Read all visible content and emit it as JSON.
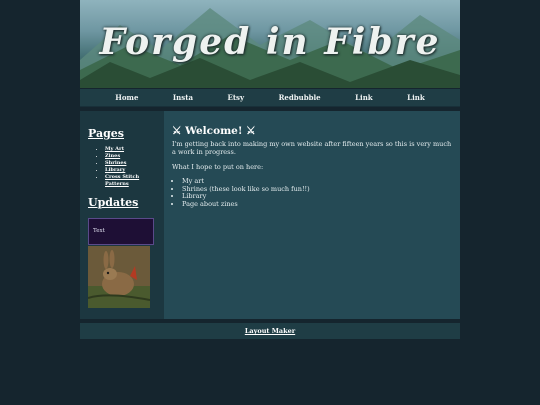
{
  "header": {
    "title": "Forged in Fibre"
  },
  "nav": [
    "Home",
    "Insta",
    "Etsy",
    "Redbubble",
    "Link",
    "Link"
  ],
  "sidebar": {
    "pages_heading": "Pages",
    "pages": [
      "My Art",
      "Zines",
      "Shrines",
      "Library",
      "Cross Stitch Patterns"
    ],
    "updates_heading": "Updates",
    "update_text": "Text"
  },
  "main": {
    "heading": "⚔ Welcome! ⚔",
    "intro": "I'm getting back into making my own website after fifteen years so this is very much a work in progress.",
    "hope": "What I hope to put on here:",
    "items": [
      "My art",
      "Shrines (these look like so much fun!!)",
      "Library",
      "Page about zines"
    ]
  },
  "footer": {
    "link": "Layout Maker"
  },
  "colors": {
    "background": "#15252e",
    "panel": "#254a55",
    "nav": "#1f3d45",
    "update_box": "#1e0f35"
  }
}
